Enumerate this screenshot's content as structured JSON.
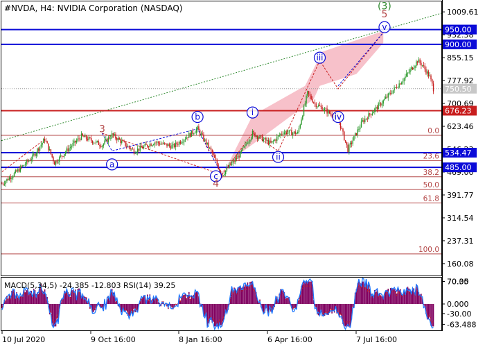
{
  "header": {
    "title": "#NVDA, H4:  NVIDIA Corporation (NASDAQ)"
  },
  "colors": {
    "bull": "#2e9a2e",
    "bear": "#c81e1e",
    "level_blue": "#0b0bd8",
    "level_red": "#c81e1e",
    "fib": "#b44848",
    "channel": "#f4a6b4",
    "trend": "#2f8a2f",
    "macd_hist": "#800060",
    "rsi": "#1e78ff",
    "signal": "#c81e1e"
  },
  "chart_data": [
    {
      "type": "candlestick",
      "ylim": [
        120,
        1045
      ],
      "y_ticks": [
        "1009.61",
        "932.38",
        "855.15",
        "777.92",
        "700.69",
        "623.46",
        "546.23",
        "469.00",
        "391.77",
        "314.54",
        "237.31",
        "160.08"
      ],
      "x_ticks": [
        "10 Jul 2020",
        "9 Oct 16:00",
        "8 Jan 16:00",
        "6 Apr 16:00",
        "7 Jul 16:00"
      ],
      "price_path": [
        [
          0,
          430
        ],
        [
          12,
          470
        ],
        [
          25,
          520
        ],
        [
          35,
          580
        ],
        [
          43,
          500
        ],
        [
          55,
          550
        ],
        [
          65,
          590
        ],
        [
          82,
          560
        ],
        [
          90,
          595
        ],
        [
          108,
          540
        ],
        [
          125,
          570
        ],
        [
          140,
          555
        ],
        [
          155,
          600
        ],
        [
          160,
          615
        ],
        [
          171,
          540
        ],
        [
          180,
          460
        ],
        [
          195,
          530
        ],
        [
          205,
          600
        ],
        [
          220,
          565
        ],
        [
          230,
          605
        ],
        [
          242,
          600
        ],
        [
          250,
          735
        ],
        [
          256,
          700
        ],
        [
          275,
          650
        ],
        [
          283,
          545
        ],
        [
          295,
          640
        ],
        [
          310,
          700
        ],
        [
          330,
          790
        ],
        [
          340,
          845
        ],
        [
          344,
          830
        ],
        [
          350,
          790
        ],
        [
          353,
          750
        ]
      ],
      "current_price": "750.50",
      "levels": [
        {
          "value": 950.0,
          "label": "950.00",
          "kind": "blue"
        },
        {
          "value": 900.0,
          "label": "900.00",
          "kind": "blue"
        },
        {
          "value": 676.23,
          "label": "676.23",
          "kind": "red"
        },
        {
          "value": 534.47,
          "label": "534.47",
          "kind": "blue"
        },
        {
          "value": 485.0,
          "label": "485.00",
          "kind": "blue"
        }
      ],
      "fib_levels": [
        {
          "value": 593.0,
          "label": "0.0"
        },
        {
          "value": 508.0,
          "label": "23.6"
        },
        {
          "value": 453.0,
          "label": "38.2"
        },
        {
          "value": 410.0,
          "label": "50.0"
        },
        {
          "value": 365.0,
          "label": "61.8"
        },
        {
          "value": 193.0,
          "label": "100.0"
        }
      ],
      "wave_labels": [
        {
          "text": "3",
          "x": 82,
          "y": 615,
          "style": "brown"
        },
        {
          "text": "a",
          "x": 90,
          "y": 495,
          "style": "circle"
        },
        {
          "text": "b",
          "x": 160,
          "y": 655,
          "style": "circle"
        },
        {
          "text": "c",
          "x": 175,
          "y": 455,
          "style": "circle"
        },
        {
          "text": "4",
          "x": 175,
          "y": 432,
          "style": "brown"
        },
        {
          "text": "i",
          "x": 205,
          "y": 670,
          "style": "circle"
        },
        {
          "text": "ii",
          "x": 226,
          "y": 520,
          "style": "circle"
        },
        {
          "text": "iii",
          "x": 260,
          "y": 855,
          "style": "circle"
        },
        {
          "text": "iv",
          "x": 275,
          "y": 655,
          "style": "circle"
        },
        {
          "text": "v",
          "x": 313,
          "y": 958,
          "style": "circle"
        },
        {
          "text": "5",
          "x": 313,
          "y": 1003,
          "style": "brown"
        },
        {
          "text": "(3)",
          "x": 313,
          "y": 1030,
          "style": "green"
        }
      ]
    },
    {
      "type": "line",
      "indicator": "MACD(5,34,5) -24.385 -12.803 RSI(14) 39.25",
      "ylim": [
        -80,
        80
      ],
      "y_ticks": [
        "70.35",
        "70.00",
        "0.000",
        "-30.00",
        "-63.488"
      ]
    }
  ]
}
